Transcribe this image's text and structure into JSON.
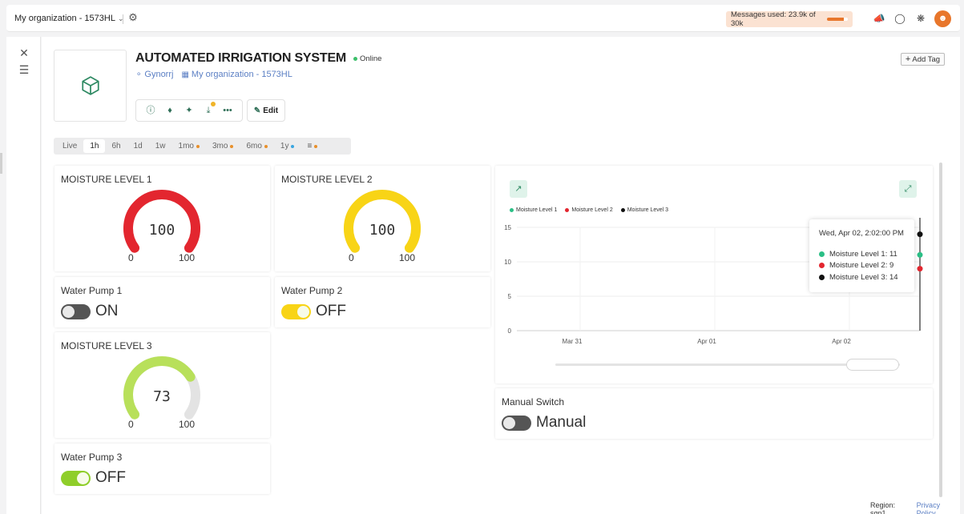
{
  "topbar": {
    "org_name": "My organization - 1573HL",
    "messages_used": "Messages used: 23.9k of 30k",
    "messages_fraction": 0.8,
    "avatar_icon": "person-icon"
  },
  "device": {
    "title": "AUTOMATED IRRIGATION SYSTEM",
    "status": "Online",
    "owner": "Gynorrj",
    "organization": "My organization - 1573HL",
    "edit_label": "Edit",
    "add_tag_label": "Add Tag"
  },
  "timebar": {
    "items": [
      {
        "label": "Live",
        "dot": ""
      },
      {
        "label": "1h",
        "dot": "",
        "active": true
      },
      {
        "label": "6h",
        "dot": ""
      },
      {
        "label": "1d",
        "dot": ""
      },
      {
        "label": "1w",
        "dot": ""
      },
      {
        "label": "1mo",
        "dot": "#e8902b"
      },
      {
        "label": "3mo",
        "dot": "#e8902b"
      },
      {
        "label": "6mo",
        "dot": "#e8902b"
      },
      {
        "label": "1y",
        "dot": "#3aa6e0"
      }
    ]
  },
  "gauges": [
    {
      "title": "MOISTURE LEVEL 1",
      "value": 100,
      "min": 0,
      "max": 100,
      "color": "#e3262f"
    },
    {
      "title": "MOISTURE LEVEL 2",
      "value": 100,
      "min": 0,
      "max": 100,
      "color": "#f8d416"
    },
    {
      "title": "MOISTURE LEVEL 3",
      "value": 73,
      "min": 0,
      "max": 100,
      "color": "#b8e05a"
    }
  ],
  "switches": [
    {
      "title": "Water Pump 1",
      "state": "ON",
      "on": false,
      "color": "#555555"
    },
    {
      "title": "Water Pump 2",
      "state": "OFF",
      "on": true,
      "color": "#f8d416"
    },
    {
      "title": "Water Pump 3",
      "state": "OFF",
      "on": true,
      "color": "#8fce2a"
    },
    {
      "title": "Manual Switch",
      "state": "Manual",
      "on": false,
      "color": "#555555"
    }
  ],
  "chart_data": {
    "type": "line",
    "series": [
      {
        "name": "Moisture Level 1",
        "color": "#2bbf86",
        "last_value": 11
      },
      {
        "name": "Moisture Level 2",
        "color": "#e3262f",
        "last_value": 9
      },
      {
        "name": "Moisture Level 3",
        "color": "#111111",
        "last_value": 14
      }
    ],
    "x_ticks": [
      "Mar 31",
      "Apr 01",
      "Apr 02"
    ],
    "y_ticks": [
      0,
      5,
      10,
      15
    ],
    "ylim": [
      0,
      15
    ],
    "grid": true,
    "legend": "top-left",
    "tooltip": {
      "date": "Wed, Apr 02, 2:02:00 PM",
      "rows": [
        "Moisture Level 1: 11",
        "Moisture Level 2: 9",
        "Moisture Level 3: 14"
      ]
    }
  },
  "footer": {
    "region": "Region: sgp1",
    "privacy": "Privacy Policy"
  }
}
